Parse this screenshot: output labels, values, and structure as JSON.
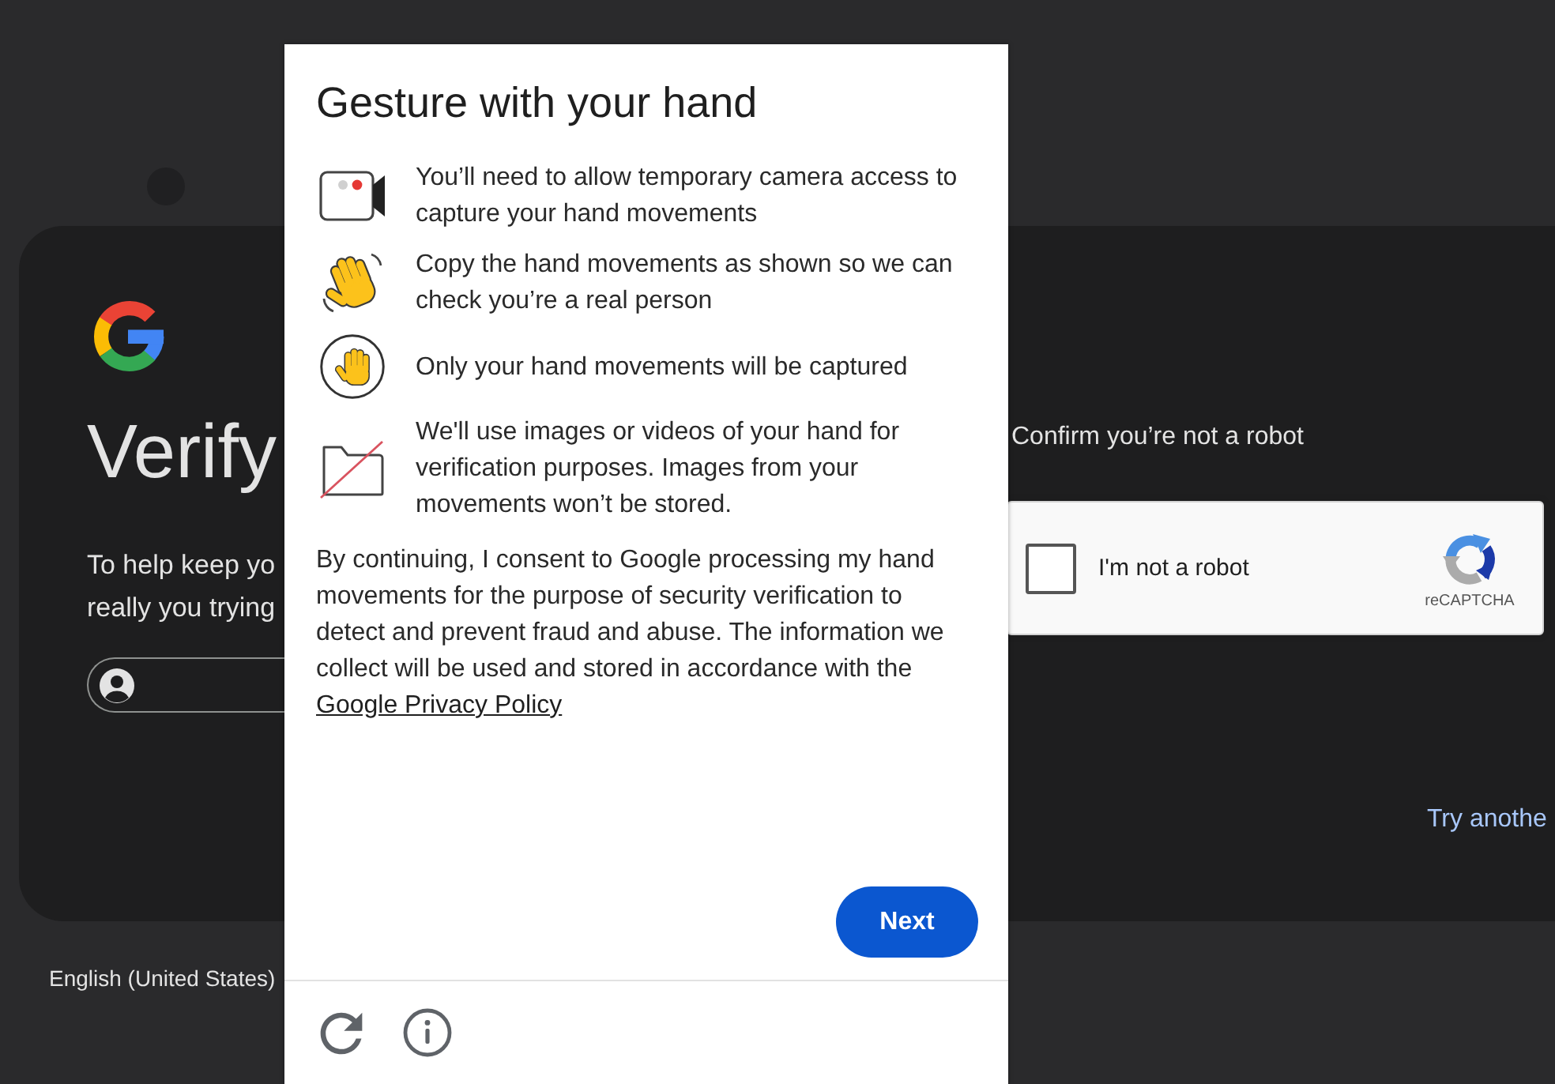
{
  "background": {
    "heading": "Verify",
    "description": [
      "To help keep yo",
      "really you trying"
    ],
    "captcha_prompt": "Confirm you’re not a robot",
    "recaptcha": {
      "label": "I'm not a robot",
      "checked": false,
      "brand": "reCAPTCHA"
    },
    "try_another": "Try anothe",
    "language": "English (United States)"
  },
  "dialog": {
    "title": "Gesture with your hand",
    "items": [
      {
        "kind": "camera",
        "text": "You’ll need to allow temporary camera access to capture your hand movements"
      },
      {
        "kind": "wave",
        "text": "Copy the hand movements as shown so we can check you’re a real person"
      },
      {
        "kind": "hand",
        "text": "Only your hand movements will be captured"
      },
      {
        "kind": "folder",
        "text": "We'll use images or videos of your hand for verification purposes. Images from your movements won’t be stored."
      }
    ],
    "consent": "By continuing, I consent to Google processing my hand movements for the purpose of security verification to detect and prevent fraud and abuse. The information we collect will be used and stored in accordance with the",
    "consent_link": "Google Privacy Policy",
    "next_button": "Next"
  }
}
